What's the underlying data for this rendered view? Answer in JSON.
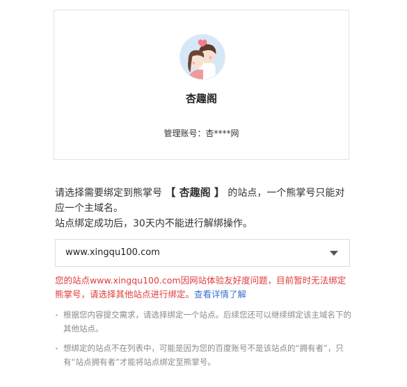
{
  "account": {
    "site_name": "杏趣阁",
    "account_label": "管理账号：",
    "account_value": "杏****网"
  },
  "intro": {
    "part1": "请选择需要绑定到熊掌号",
    "bracket_name": "【 杏趣阁 】",
    "part2": "的站点，一个熊掌号只能对应一个主域名。",
    "line2": "站点绑定成功后，30天内不能进行解绑操作。"
  },
  "select": {
    "value": "www.xingqu100.com"
  },
  "error": {
    "text": "您的站点www.xingqu100.com因网站体验友好度问题，目前暂时无法绑定熊掌号，请选择其他站点进行绑定。",
    "link_label": "查看详情了解"
  },
  "tips": [
    "根据您内容提交需求，请选择绑定一个站点。后续您还可以继续绑定该主域名下的其他站点。",
    "想绑定的站点不在列表中，可能是因为您的百度账号不是该站点的“拥有者”，只有“站点拥有者”才能将站点绑定至熊掌号。"
  ],
  "colors": {
    "error": "#e03a3a",
    "link": "#3b6fd4",
    "tip_text": "#8a8a8a",
    "border": "#dcdcdc"
  },
  "icons": {
    "avatar": "couple-avatar-illustration",
    "select_caret": "caret-down-icon",
    "tip_bullet": "bullet-dot"
  }
}
